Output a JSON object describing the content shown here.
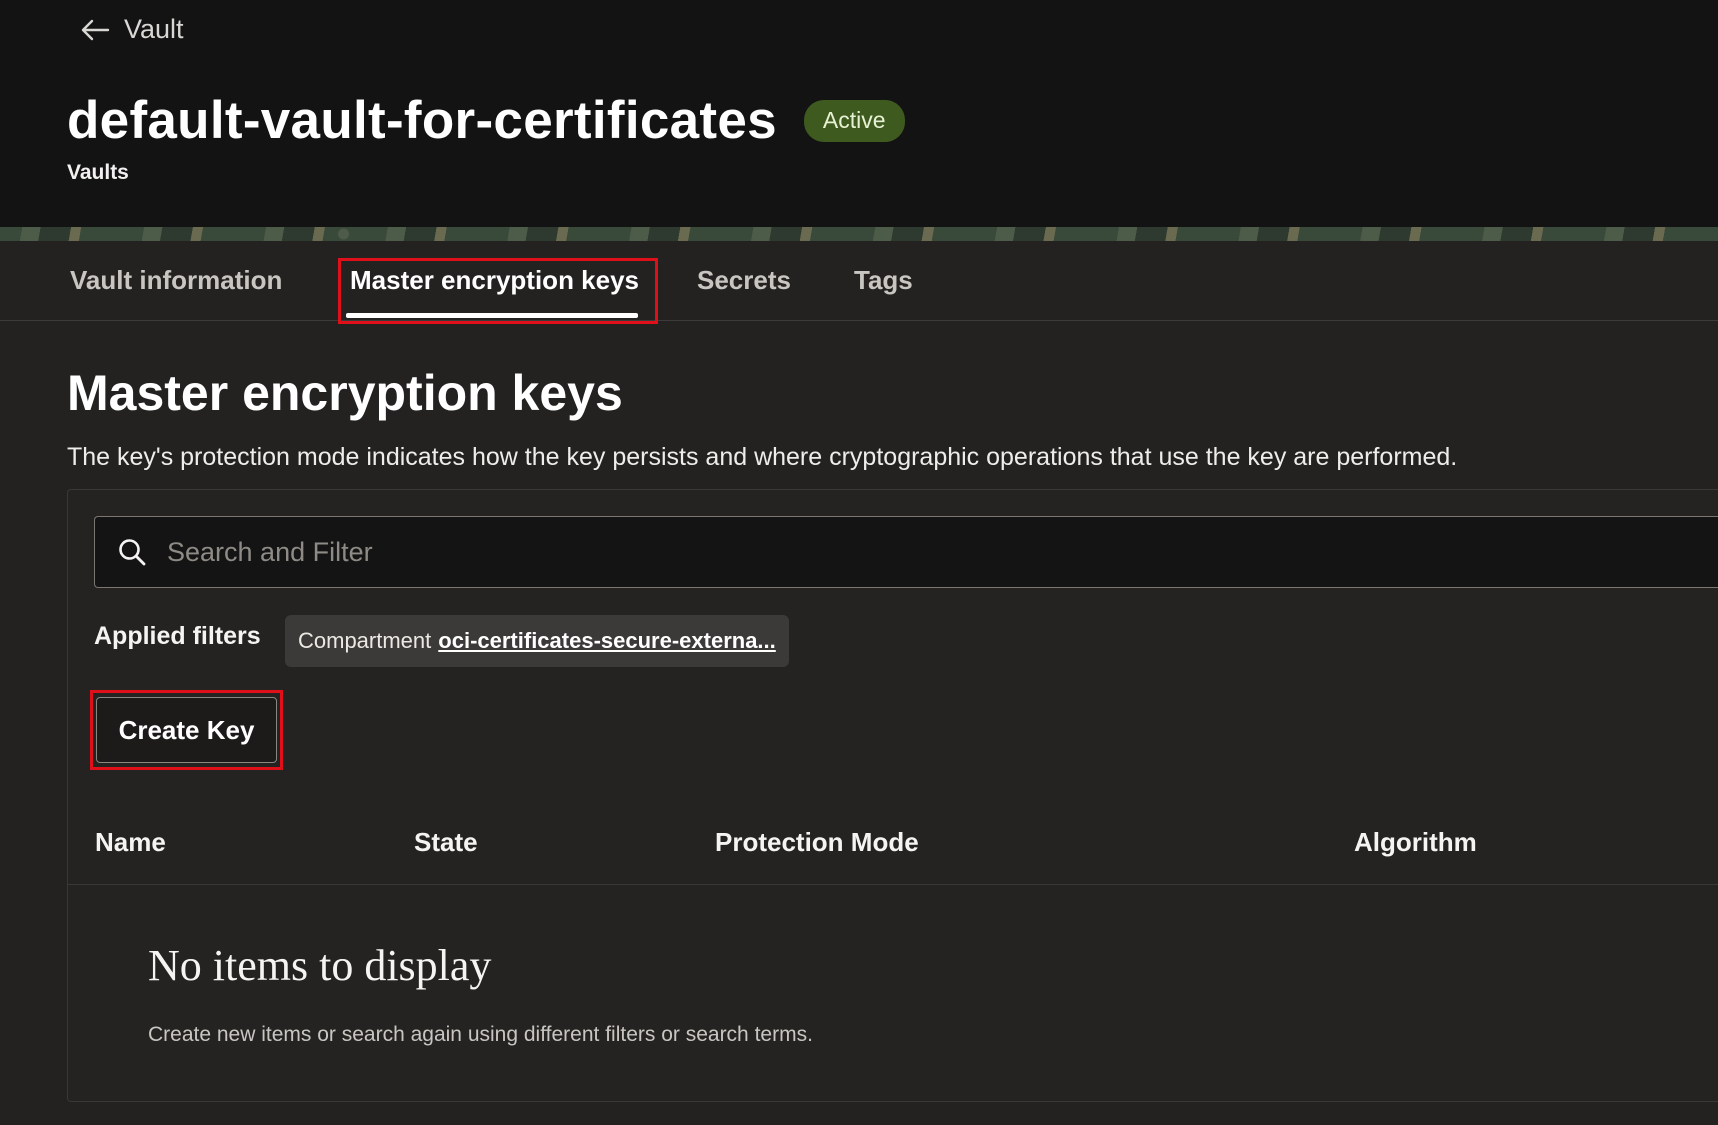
{
  "header": {
    "back_label": "Vault",
    "title": "default-vault-for-certificates",
    "status": "Active",
    "subtitle": "Vaults"
  },
  "tabs": [
    {
      "label": "Vault information",
      "active": false
    },
    {
      "label": "Master encryption keys",
      "active": true
    },
    {
      "label": "Secrets",
      "active": false
    },
    {
      "label": "Tags",
      "active": false
    }
  ],
  "section": {
    "title": "Master encryption keys",
    "description": "The key's protection mode indicates how the key persists and where cryptographic operations that use the key are performed."
  },
  "search": {
    "placeholder": "Search and Filter"
  },
  "filters": {
    "label": "Applied filters",
    "chip_key": "Compartment",
    "chip_value": "oci-certificates-secure-externa..."
  },
  "actions": {
    "create_label": "Create Key"
  },
  "table": {
    "columns": [
      "Name",
      "State",
      "Protection Mode",
      "Algorithm"
    ]
  },
  "empty_state": {
    "title": "No items to display",
    "description": "Create new items or search again using different filters or search terms."
  },
  "colors": {
    "background": "#232221",
    "header_background": "#141313",
    "status_badge": "#3e5a1f",
    "highlight": "#e0101a"
  },
  "icons": {
    "back": "arrow-left-icon",
    "search": "search-icon"
  }
}
